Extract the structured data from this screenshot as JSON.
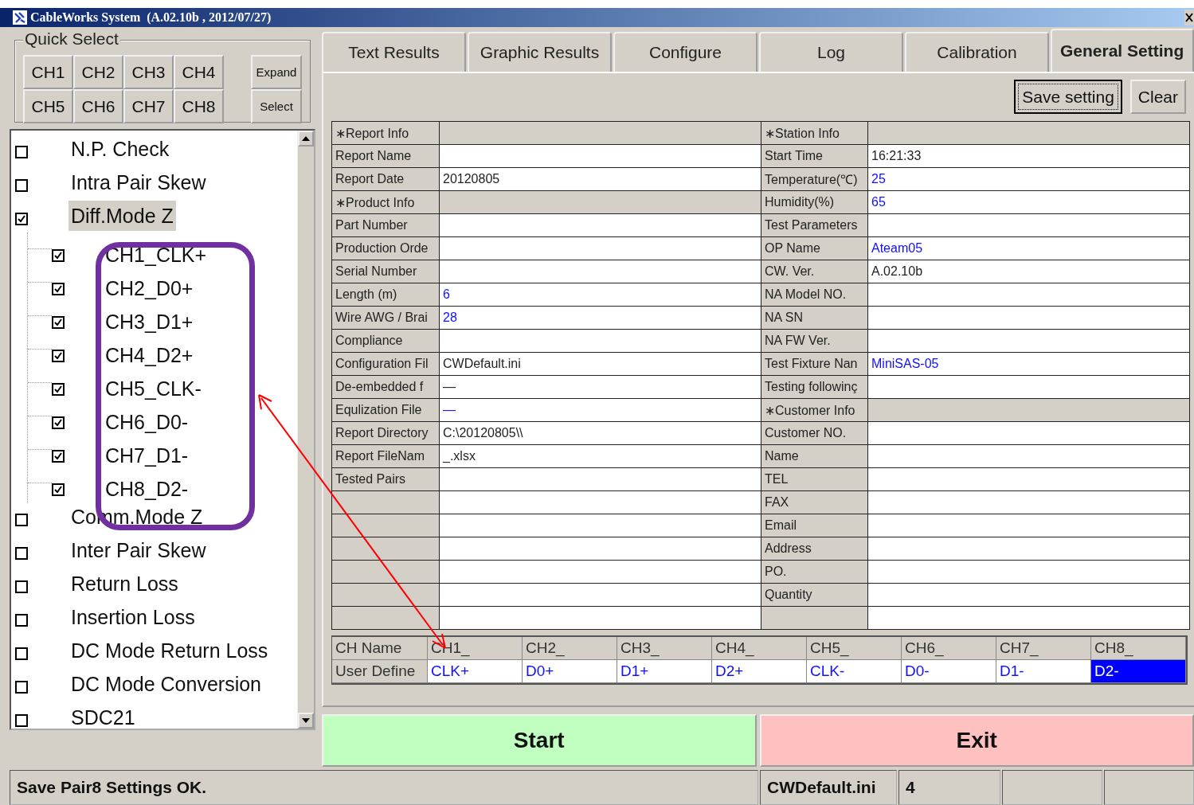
{
  "window": {
    "title": "CableWorks System  (A.02.10b , 2012/07/27)"
  },
  "quick_select": {
    "title": "Quick Select",
    "channels": [
      "CH1",
      "CH2",
      "CH3",
      "CH4",
      "CH5",
      "CH6",
      "CH7",
      "CH8"
    ],
    "buttons": [
      "Expand",
      "Select"
    ]
  },
  "tests": [
    {
      "label": "N.P. Check",
      "checked": false,
      "selected": false
    },
    {
      "label": "Intra Pair Skew",
      "checked": false,
      "selected": false
    },
    {
      "label": "Diff.Mode Z",
      "checked": true,
      "selected": true,
      "children": [
        {
          "label": "CH1_CLK+",
          "checked": true
        },
        {
          "label": "CH2_D0+",
          "checked": true
        },
        {
          "label": "CH3_D1+",
          "checked": true
        },
        {
          "label": "CH4_D2+",
          "checked": true
        },
        {
          "label": "CH5_CLK-",
          "checked": true
        },
        {
          "label": "CH6_D0-",
          "checked": true
        },
        {
          "label": "CH7_D1-",
          "checked": true
        },
        {
          "label": "CH8_D2-",
          "checked": true
        }
      ]
    },
    {
      "label": "Comm.Mode Z",
      "checked": false,
      "selected": false
    },
    {
      "label": "Inter Pair Skew",
      "checked": false,
      "selected": false
    },
    {
      "label": "Return Loss",
      "checked": false,
      "selected": false
    },
    {
      "label": "Insertion Loss",
      "checked": false,
      "selected": false
    },
    {
      "label": "DC Mode Return Loss",
      "checked": false,
      "selected": false
    },
    {
      "label": "DC Mode Conversion",
      "checked": false,
      "selected": false
    },
    {
      "label": "SDC21",
      "checked": false,
      "selected": false
    }
  ],
  "tabs": [
    {
      "label": "Text Results",
      "selected": false
    },
    {
      "label": "Graphic Results",
      "selected": false
    },
    {
      "label": "Configure",
      "selected": false
    },
    {
      "label": "Log",
      "selected": false
    },
    {
      "label": "Calibration",
      "selected": false
    },
    {
      "label": "General Setting",
      "selected": true
    }
  ],
  "toolbar": {
    "buttons": [
      {
        "label": "Save setting",
        "focused": true
      },
      {
        "label": "Clear",
        "focused": false
      }
    ]
  },
  "settings_left": [
    {
      "kind": "section",
      "label": "∗Report Info"
    },
    {
      "kind": "field",
      "label": "Report Name"
    },
    {
      "kind": "field",
      "label": "Report Date",
      "value": "20120805",
      "user": false
    },
    {
      "kind": "section",
      "label": "∗Product Info"
    },
    {
      "kind": "field",
      "label": "Part Number"
    },
    {
      "kind": "field",
      "label": "Production Orde"
    },
    {
      "kind": "field",
      "label": "Serial Number"
    },
    {
      "kind": "field",
      "label": "Length (m)",
      "value": "6",
      "user": true
    },
    {
      "kind": "field",
      "label": "Wire AWG / Brai",
      "value": "28",
      "user": true
    },
    {
      "kind": "field",
      "label": "Compliance"
    },
    {
      "kind": "field",
      "label": "Configuration Fil",
      "value": "CWDefault.ini",
      "user": false
    },
    {
      "kind": "field",
      "label": "De-embedded f",
      "value": "—",
      "user": false
    },
    {
      "kind": "field",
      "label": "Equlization File",
      "value": "—",
      "user": true
    },
    {
      "kind": "field",
      "label": "Report Directory",
      "value": "C:\\20120805\\\\",
      "user": false
    },
    {
      "kind": "field",
      "label": "Report FileNam",
      "value": "_.xlsx",
      "user": false
    },
    {
      "kind": "field",
      "label": "Tested Pairs"
    },
    {
      "kind": "blank"
    },
    {
      "kind": "blank"
    },
    {
      "kind": "blank"
    },
    {
      "kind": "blank"
    },
    {
      "kind": "blank"
    },
    {
      "kind": "blank"
    }
  ],
  "settings_right": [
    {
      "kind": "section",
      "label": "∗Station Info"
    },
    {
      "kind": "field",
      "label": "Start Time",
      "value": "16:21:33",
      "user": false
    },
    {
      "kind": "field",
      "label": "Temperature(℃)",
      "value": "25",
      "user": true
    },
    {
      "kind": "field",
      "label": "Humidity(%)",
      "value": "65",
      "user": true
    },
    {
      "kind": "field",
      "label": "Test Parameters"
    },
    {
      "kind": "field",
      "label": "OP Name",
      "value": "Ateam05",
      "user": true
    },
    {
      "kind": "field",
      "label": "CW. Ver.",
      "value": "A.02.10b",
      "user": false
    },
    {
      "kind": "field",
      "label": "NA Model NO."
    },
    {
      "kind": "field",
      "label": "NA SN"
    },
    {
      "kind": "field",
      "label": "NA FW Ver."
    },
    {
      "kind": "field",
      "label": "Test Fixture Nan",
      "value": "MiniSAS-05",
      "user": true
    },
    {
      "kind": "field",
      "label": "Testing followinç"
    },
    {
      "kind": "section",
      "label": "∗Customer Info"
    },
    {
      "kind": "field",
      "label": "Customer NO."
    },
    {
      "kind": "field",
      "label": "Name"
    },
    {
      "kind": "field",
      "label": "TEL"
    },
    {
      "kind": "field",
      "label": "FAX"
    },
    {
      "kind": "field",
      "label": "Email"
    },
    {
      "kind": "field",
      "label": "Address"
    },
    {
      "kind": "field",
      "label": "PO."
    },
    {
      "kind": "field",
      "label": "Quantity"
    },
    {
      "kind": "blank"
    }
  ],
  "channel_names": {
    "row_labels": [
      "CH Name",
      "User Define"
    ],
    "columns": [
      {
        "name": "CH1_",
        "value": "CLK+",
        "selected": false
      },
      {
        "name": "CH2_",
        "value": "D0+",
        "selected": false
      },
      {
        "name": "CH3_",
        "value": "D1+",
        "selected": false
      },
      {
        "name": "CH4_",
        "value": "D2+",
        "selected": false
      },
      {
        "name": "CH5_",
        "value": "CLK-",
        "selected": false
      },
      {
        "name": "CH6_",
        "value": "D0-",
        "selected": false
      },
      {
        "name": "CH7_",
        "value": "D1-",
        "selected": false
      },
      {
        "name": "CH8_",
        "value": "D2-",
        "selected": true
      }
    ]
  },
  "actions": [
    {
      "kind": "start",
      "label": "Start"
    },
    {
      "kind": "exit",
      "label": "Exit"
    }
  ],
  "status_bar": {
    "message": "Save Pair8 Settings OK.",
    "panels": [
      "CWDefault.ini",
      "4"
    ]
  }
}
